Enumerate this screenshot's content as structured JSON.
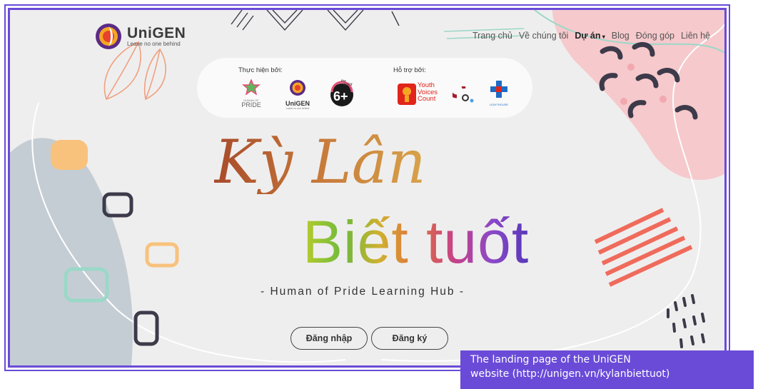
{
  "nav": {
    "logo_name": "UniGEN",
    "logo_tagline": "Leave no one behind",
    "menu": [
      "Trang chủ",
      "Về chúng tôi",
      "Dự án",
      "Blog",
      "Đóng góp",
      "Liên hệ"
    ],
    "active_item": "Dự án"
  },
  "sponsors": {
    "implemented_by_label": "Thực hiện bởi:",
    "supported_by_label": "Hỗ trợ bởi:",
    "implemented": {
      "pride_top": "HUMAN OF",
      "pride_bottom": "PRIDE",
      "unigen_name": "UniGEN",
      "unigen_tagline": "Leave no one behind",
      "sixplus_top": "the",
      "sixplus_mid": "color",
      "sixplus_num": "6+"
    },
    "supported": {
      "yvc_line1": "Youth",
      "yvc_line2": "Voices",
      "yvc_line3": "Count",
      "lighthouse": "LIGHTHOUSE"
    }
  },
  "hero": {
    "title_line1": "Kỳ Lân",
    "title_line2": "Biết tuốt",
    "subtitle": "- Human of Pride Learning Hub -"
  },
  "buttons": {
    "login": "Đăng nhập",
    "register": "Đăng ký"
  },
  "caption": {
    "line1": "The landing page of the UniGEN",
    "line2": "website (http://unigen.vn/kylanbiettuot)"
  },
  "colors": {
    "frame": "#6a4bd8",
    "background": "#efeeee",
    "caption_bg": "#6a4bd8",
    "pink": "#f6c9cc",
    "coral": "#ef6b5c",
    "teal": "#9bd8c8",
    "orange": "#f8c27c",
    "slate": "#c5cdd4",
    "navy": "#3d3a4a"
  }
}
